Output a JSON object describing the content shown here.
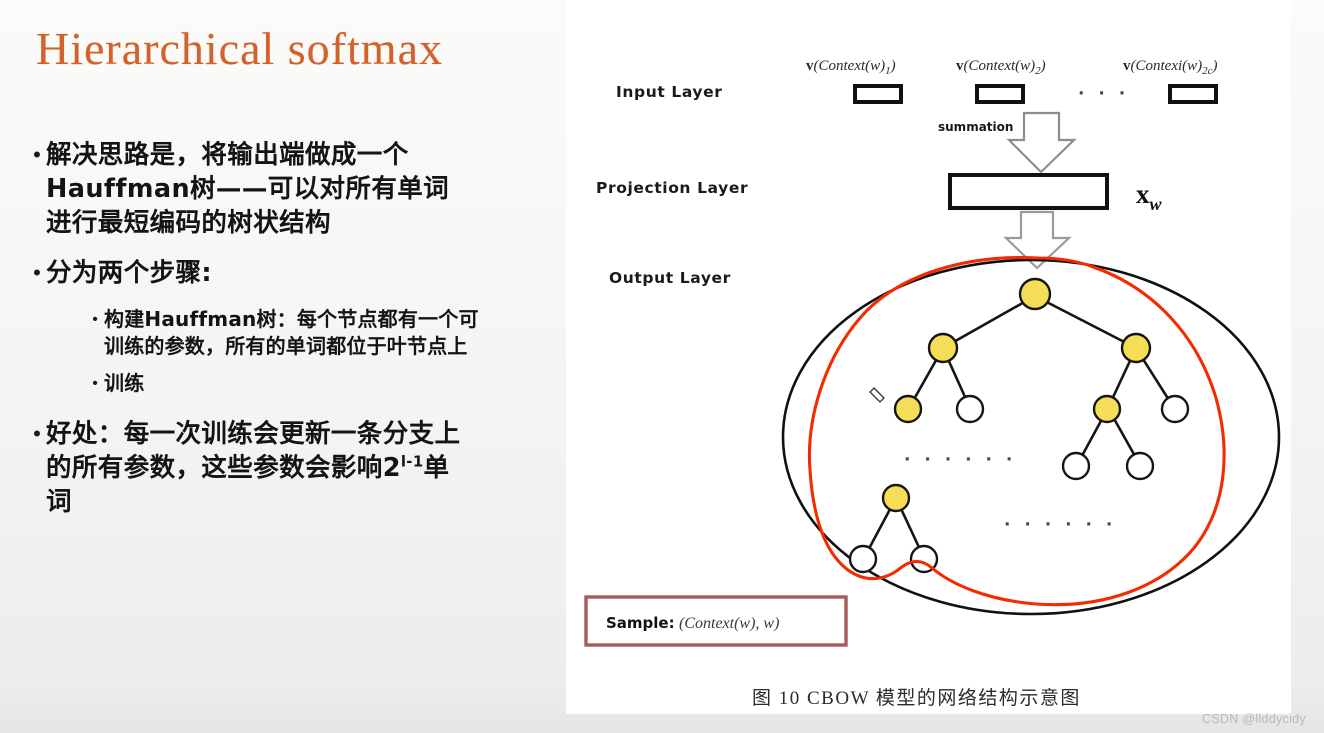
{
  "slide": {
    "title": "Hierarchical  softmax",
    "title_color": "#d2622b",
    "bullets": [
      {
        "level": 1,
        "text": "解决思路是，将输出端做成一个Hauffman树——可以对所有单词进行最短编码的树状结构"
      },
      {
        "level": 1,
        "text": "分为两个步骤:"
      },
      {
        "level": 2,
        "text": "构建Hauffman树：每个节点都有一个可训练的参数，所有的单词都位于叶节点上"
      },
      {
        "level": 2,
        "text": "训练"
      },
      {
        "level": 1,
        "text_before_sup": "好处：每一次训练会更新一条分支上的所有参数，这些参数会影响2",
        "sup": "l-1",
        "text_after_sup": "单词"
      }
    ]
  },
  "diagram": {
    "layers": {
      "input": "Input  Layer",
      "projection": "Projection  Layer",
      "output": "Output Layer"
    },
    "summation_label": "summation",
    "input_vectors": [
      {
        "bold": "v",
        "italic": "(Context(w)",
        "sub": "1",
        "close": ")"
      },
      {
        "bold": "v",
        "italic": "(Context(w)",
        "sub": "2",
        "close": ")"
      },
      {
        "bold": "v",
        "italic": "(Contexi(w)",
        "sub": "2c",
        "close": ")"
      }
    ],
    "input_ellipsis": "· · ·",
    "projection_output_label_main": "x",
    "projection_output_label_sub": "w",
    "sample_box": {
      "label": "Sample:",
      "value": "(Context(w), w)",
      "border_color": "#a85a5a"
    },
    "caption": "图 10  CBOW 模型的网络结构示意图",
    "tree_ellipsis_1": "· · · · · ·",
    "tree_ellipsis_2": "· · · · · ·",
    "node_fill_internal": "#f5dd58",
    "node_fill_leaf": "#ffffff",
    "annotation_color": "#f42b00"
  },
  "watermark": "CSDN @llddycidy"
}
